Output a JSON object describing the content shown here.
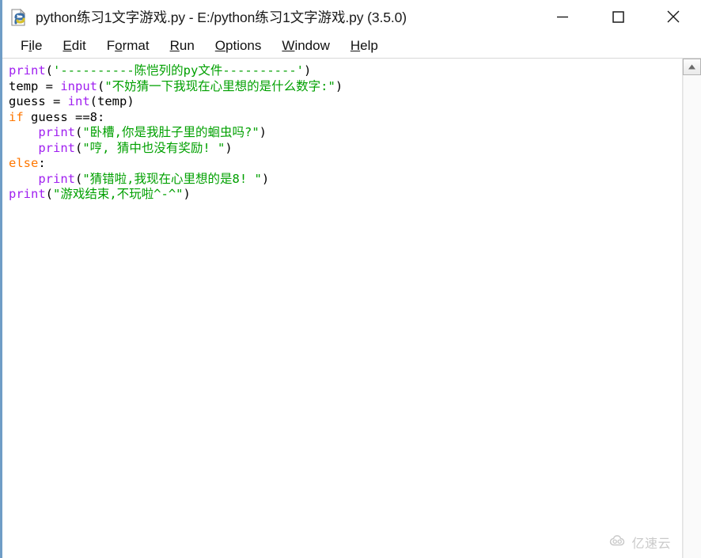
{
  "window": {
    "title": "python练习1文字游戏.py - E:/python练习1文字游戏.py (3.5.0)",
    "icon": "python-file-icon",
    "border_color": "#6f9dc6",
    "controls": {
      "minimize_label": "–",
      "maximize_label": "□",
      "close_label": "✕"
    }
  },
  "menubar": {
    "items": [
      {
        "label": "File",
        "pre": "F",
        "mnemonic": "i",
        "post": "le"
      },
      {
        "label": "Edit",
        "pre": "",
        "mnemonic": "E",
        "post": "dit"
      },
      {
        "label": "Format",
        "pre": "F",
        "mnemonic": "o",
        "post": "rmat"
      },
      {
        "label": "Run",
        "pre": "",
        "mnemonic": "R",
        "post": "un"
      },
      {
        "label": "Options",
        "pre": "",
        "mnemonic": "O",
        "post": "ptions"
      },
      {
        "label": "Window",
        "pre": "",
        "mnemonic": "W",
        "post": "indow"
      },
      {
        "label": "Help",
        "pre": "",
        "mnemonic": "H",
        "post": "elp"
      }
    ]
  },
  "editor": {
    "language": "python",
    "colors": {
      "builtin": "#a020f0",
      "string": "#00a000",
      "keyword": "#ff7700",
      "plain": "#000000",
      "background": "#ffffff"
    },
    "lines": [
      [
        {
          "t": "print",
          "c": "def"
        },
        {
          "t": "(",
          "c": "plain"
        },
        {
          "t": "'----------陈恺列的py文件----------'",
          "c": "str"
        },
        {
          "t": ")",
          "c": "plain"
        }
      ],
      [
        {
          "t": "temp = ",
          "c": "plain"
        },
        {
          "t": "input",
          "c": "def"
        },
        {
          "t": "(",
          "c": "plain"
        },
        {
          "t": "\"不妨猜一下我现在心里想的是什么数字:\"",
          "c": "str"
        },
        {
          "t": ")",
          "c": "plain"
        }
      ],
      [
        {
          "t": "guess = ",
          "c": "plain"
        },
        {
          "t": "int",
          "c": "def"
        },
        {
          "t": "(temp)",
          "c": "plain"
        }
      ],
      [
        {
          "t": "if",
          "c": "kw"
        },
        {
          "t": " guess ==8:",
          "c": "plain"
        }
      ],
      [
        {
          "t": "    ",
          "c": "plain"
        },
        {
          "t": "print",
          "c": "def"
        },
        {
          "t": "(",
          "c": "plain"
        },
        {
          "t": "\"卧槽,你是我肚子里的蛔虫吗?\"",
          "c": "str"
        },
        {
          "t": ")",
          "c": "plain"
        }
      ],
      [
        {
          "t": "    ",
          "c": "plain"
        },
        {
          "t": "print",
          "c": "def"
        },
        {
          "t": "(",
          "c": "plain"
        },
        {
          "t": "\"哼, 猜中也没有奖励! \"",
          "c": "str"
        },
        {
          "t": ")",
          "c": "plain"
        }
      ],
      [
        {
          "t": "else",
          "c": "kw"
        },
        {
          "t": ":",
          "c": "plain"
        }
      ],
      [
        {
          "t": "    ",
          "c": "plain"
        },
        {
          "t": "print",
          "c": "def"
        },
        {
          "t": "(",
          "c": "plain"
        },
        {
          "t": "\"猜错啦,我现在心里想的是8! \"",
          "c": "str"
        },
        {
          "t": ")",
          "c": "plain"
        }
      ],
      [
        {
          "t": "print",
          "c": "def"
        },
        {
          "t": "(",
          "c": "plain"
        },
        {
          "t": "\"游戏结束,不玩啦^-^\"",
          "c": "str"
        },
        {
          "t": ")",
          "c": "plain"
        }
      ]
    ]
  },
  "scrollbar": {
    "up_arrow": "scroll-up-arrow",
    "position": "top"
  },
  "watermark": {
    "text": "亿速云",
    "icon": "cloud-icon"
  }
}
